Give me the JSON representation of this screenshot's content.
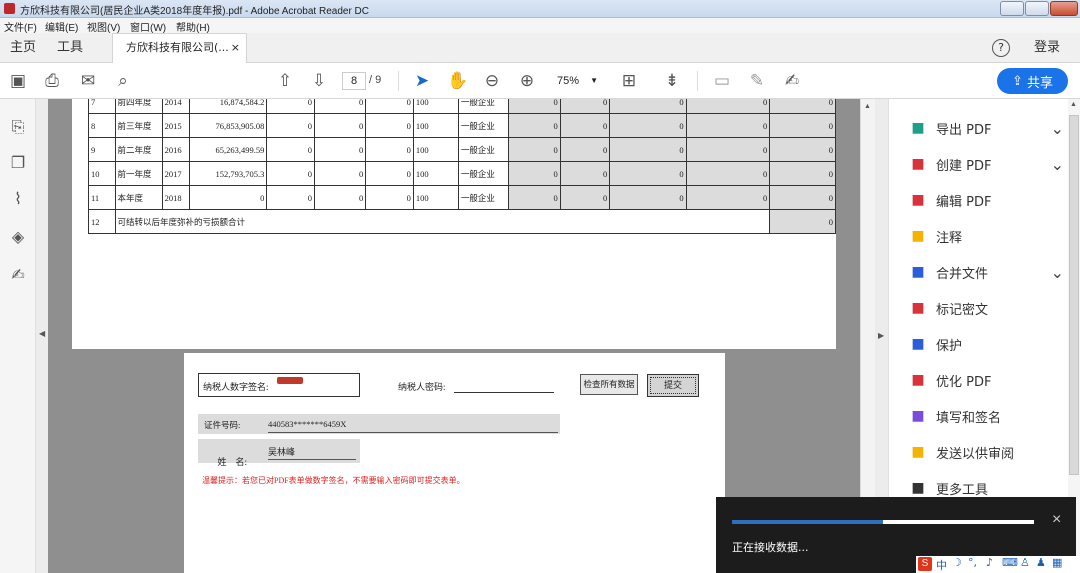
{
  "window": {
    "title": "方欣科技有限公司(居民企业A类2018年度年报).pdf - Adobe Acrobat Reader DC"
  },
  "menu": [
    "文件(F)",
    "编辑(E)",
    "视图(V)",
    "窗口(W)",
    "帮助(H)"
  ],
  "tabs": {
    "home": "主页",
    "tools": "工具",
    "document": "方欣科技有限公司(... ",
    "close": "×",
    "help": "?",
    "login": "登录"
  },
  "toolbar": {
    "page_current": "8",
    "page_total": "/ 9",
    "zoom": "75%",
    "share": "共享"
  },
  "table": {
    "rows": [
      {
        "n": "7",
        "label": "前四年度",
        "year": "2014",
        "amount": "16,874,584.2",
        "c1": "0",
        "c2": "0",
        "c3": "0",
        "rate": "100",
        "type": "一般企业",
        "d1": "0",
        "d2": "0",
        "d3": "0",
        "d4": "0",
        "d5": "0"
      },
      {
        "n": "8",
        "label": "前三年度",
        "year": "2015",
        "amount": "76,853,905.08",
        "c1": "0",
        "c2": "0",
        "c3": "0",
        "rate": "100",
        "type": "一般企业",
        "d1": "0",
        "d2": "0",
        "d3": "0",
        "d4": "0",
        "d5": "0"
      },
      {
        "n": "9",
        "label": "前二年度",
        "year": "2016",
        "amount": "65,263,499.59",
        "c1": "0",
        "c2": "0",
        "c3": "0",
        "rate": "100",
        "type": "一般企业",
        "d1": "0",
        "d2": "0",
        "d3": "0",
        "d4": "0",
        "d5": "0"
      },
      {
        "n": "10",
        "label": "前一年度",
        "year": "2017",
        "amount": "152,793,705.3",
        "c1": "0",
        "c2": "0",
        "c3": "0",
        "rate": "100",
        "type": "一般企业",
        "d1": "0",
        "d2": "0",
        "d3": "0",
        "d4": "0",
        "d5": "0"
      },
      {
        "n": "11",
        "label": "本年度",
        "year": "2018",
        "amount": "0",
        "c1": "0",
        "c2": "0",
        "c3": "0",
        "rate": "100",
        "type": "一般企业",
        "d1": "0",
        "d2": "0",
        "d3": "0",
        "d4": "0",
        "d5": "0"
      }
    ],
    "total_n": "12",
    "total_label": "可结转以后年度弥补的亏损额合计",
    "total_value": "0"
  },
  "form": {
    "sig_label": "纳税人数字签名:",
    "pwd_label": "纳税人密码:",
    "check_btn": "检查所有数据",
    "submit_btn": "提交",
    "cert_label": "证件号码:",
    "cert_value": "440583*******6459X",
    "name_label": "姓    名:",
    "name_value": "吴林峰",
    "tip": "温馨提示：若您已对PDF表单做数字签名，不需要输入密码即可提交表单。"
  },
  "right_panel": [
    {
      "label": "导出 PDF",
      "icon": "export-pdf-icon",
      "chev": true,
      "color": "#1f9e8a"
    },
    {
      "label": "创建 PDF",
      "icon": "create-pdf-icon",
      "chev": true,
      "color": "#d8323a"
    },
    {
      "label": "编辑 PDF",
      "icon": "edit-pdf-icon",
      "chev": false,
      "color": "#d8323a"
    },
    {
      "label": "注释",
      "icon": "comment-icon",
      "chev": false,
      "color": "#f2b400"
    },
    {
      "label": "合并文件",
      "icon": "combine-files-icon",
      "chev": true,
      "color": "#2b5fd9"
    },
    {
      "label": "标记密文",
      "icon": "redact-icon",
      "chev": false,
      "color": "#d8323a"
    },
    {
      "label": "保护",
      "icon": "protect-icon",
      "chev": false,
      "color": "#2b5fd9"
    },
    {
      "label": "优化 PDF",
      "icon": "optimize-pdf-icon",
      "chev": false,
      "color": "#d8323a"
    },
    {
      "label": "填写和签名",
      "icon": "fill-sign-icon",
      "chev": false,
      "color": "#7a4cd9"
    },
    {
      "label": "发送以供审阅",
      "icon": "send-review-icon",
      "chev": false,
      "color": "#f2b400"
    },
    {
      "label": "更多工具",
      "icon": "more-tools-icon",
      "chev": false,
      "color": "#333333"
    }
  ],
  "toast": {
    "message": "正在接收数据...",
    "progress": 0.5
  },
  "ime": {
    "text": "中"
  }
}
